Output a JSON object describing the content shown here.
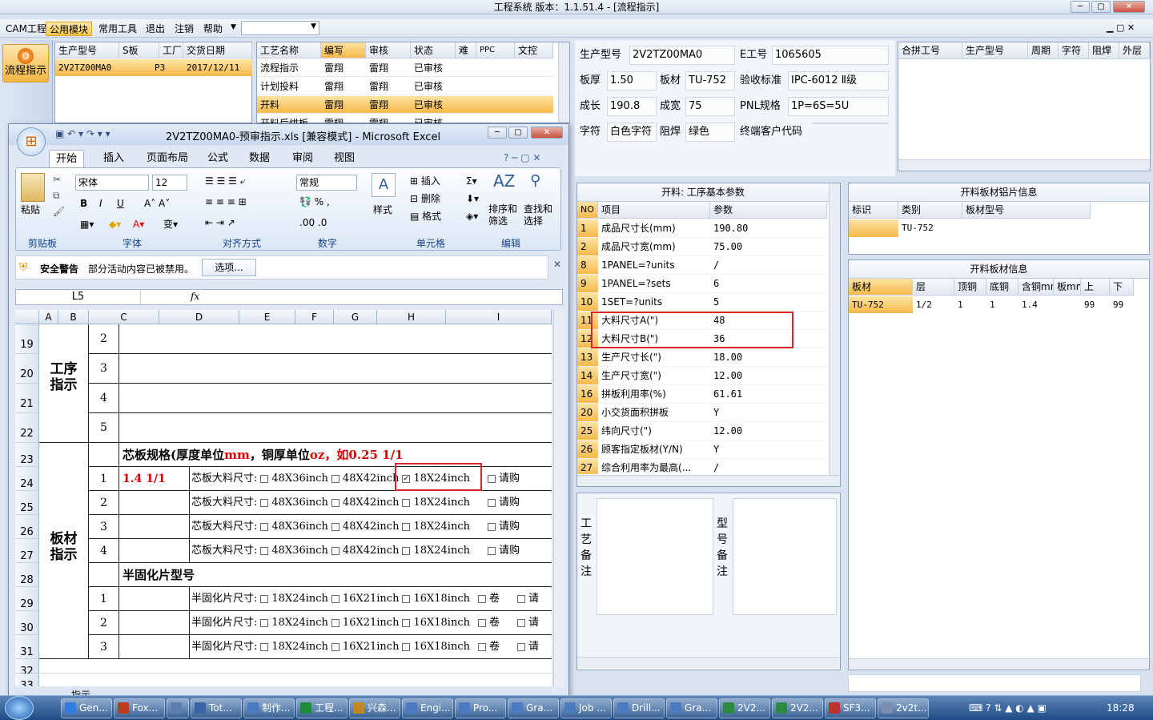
{
  "app": {
    "title": "工程系统   版本：1.1.51.4 - [流程指示]"
  },
  "menu": {
    "items": [
      "CAM工程",
      "公用模块",
      "常用工具",
      "退出",
      "注销",
      "帮助"
    ],
    "active_index": 1
  },
  "sidebar": {
    "button_label": "流程指示"
  },
  "product_grid": {
    "headers": [
      "生产型号",
      "S板",
      "工厂",
      "交货日期"
    ],
    "rows": [
      [
        "2V2TZ00MA0",
        "",
        "P3",
        "2017/12/11"
      ]
    ]
  },
  "process_grid": {
    "headers": [
      "工艺名称",
      "编写",
      "审核",
      "状态",
      "难",
      "PPC",
      "文控"
    ],
    "rows": [
      [
        "流程指示",
        "雷翔",
        "雷翔",
        "已审核"
      ],
      [
        "计划投料",
        "雷翔",
        "雷翔",
        "已审核"
      ],
      [
        "开料",
        "雷翔",
        "雷翔",
        "已审核"
      ],
      [
        "开料后烘板",
        "雷翔",
        "雷翔",
        "已审核"
      ]
    ],
    "selected_index": 2
  },
  "info": {
    "model_label": "生产型号",
    "model": "2V2TZ00MA0",
    "eno_label": "E工号",
    "eno": "1065605",
    "thick_label": "板厚",
    "thick": "1.50",
    "material_label": "板材",
    "material": "TU-752",
    "std_label": "验收标准",
    "std": "IPC-6012 Ⅱ级",
    "len_label": "成长",
    "len": "190.8",
    "wid_label": "成宽",
    "wid": "75",
    "pnl_label": "PNL规格",
    "pnl": "1P=6S=5U",
    "char_label": "字符",
    "char": "白色字符",
    "mask_label": "阻焊",
    "mask": "绿色",
    "cust_label": "终端客户代码",
    "cust": ""
  },
  "merge_grid": {
    "headers": [
      "合拼工号",
      "生产型号",
      "周期",
      "字符",
      "阻焊",
      "外层"
    ]
  },
  "params": {
    "title": "开料: 工序基本参数",
    "headers": [
      "NO",
      "项目",
      "参数"
    ],
    "rows": [
      [
        "1",
        "成品尺寸长(mm)",
        "190.80"
      ],
      [
        "2",
        "成品尺寸宽(mm)",
        "75.00"
      ],
      [
        "8",
        "1PANEL=?units",
        "/"
      ],
      [
        "9",
        "1PANEL=?sets",
        "6"
      ],
      [
        "10",
        "1SET=?units",
        "5"
      ],
      [
        "11",
        "大料尺寸A(\")",
        "48"
      ],
      [
        "12",
        "大料尺寸B(\")",
        "36"
      ],
      [
        "13",
        "生产尺寸长(\")",
        "18.00"
      ],
      [
        "14",
        "生产尺寸宽(\")",
        "12.00"
      ],
      [
        "16",
        "拼板利用率(%)",
        "61.61"
      ],
      [
        "20",
        "小交货面积拼板",
        "Y"
      ],
      [
        "25",
        "纬向尺寸(\")",
        "12.00"
      ],
      [
        "26",
        "顾客指定板材(Y/N)",
        "Y"
      ],
      [
        "27",
        "综合利用率为最高(...",
        "/"
      ]
    ]
  },
  "notes": {
    "process_label": "工艺备注",
    "model_label": "型号备注"
  },
  "cu_foil": {
    "title": "开料板材铝片信息",
    "headers": [
      "标识",
      "类别",
      "板材型号"
    ],
    "rows": [
      [
        "",
        "TU-752",
        ""
      ]
    ]
  },
  "board_info": {
    "title": "开料板材信息",
    "headers": [
      "板材",
      "层",
      "顶铜",
      "底铜",
      "含铜mm",
      "板mm",
      "上",
      "下"
    ],
    "rows": [
      [
        "TU-752",
        "1/2",
        "1",
        "1",
        "1.4",
        "",
        "99",
        "99"
      ]
    ]
  },
  "excel": {
    "title": "2V2TZ00MA0-预审指示.xls  [兼容模式] - Microsoft Excel",
    "tabs": [
      "开始",
      "插入",
      "页面布局",
      "公式",
      "数据",
      "审阅",
      "视图"
    ],
    "clipboard": {
      "paste": "粘贴",
      "group": "剪贴板"
    },
    "font": {
      "name": "宋体",
      "size": "12",
      "group": "字体"
    },
    "align_group": "对齐方式",
    "number": {
      "format": "常规",
      "group": "数字"
    },
    "styles": "样式",
    "cells": {
      "insert": "插入",
      "delete": "删除",
      "format": "格式",
      "group": "单元格"
    },
    "edit": {
      "sort": "排序和筛选",
      "find": "查找和选择",
      "group": "编辑"
    },
    "security": {
      "label": "安全警告",
      "text": "部分活动内容已被禁用。",
      "options": "选项..."
    },
    "namebox": "L5",
    "col_headers": [
      "A",
      "B",
      "C",
      "D",
      "E",
      "F",
      "G",
      "H",
      "I"
    ],
    "row_numbers": [
      "19",
      "20",
      "21",
      "22",
      "23",
      "24",
      "25",
      "26",
      "27",
      "28",
      "29",
      "30",
      "31",
      "32",
      "33"
    ],
    "process_label": "工序指示",
    "board_label": "板材指示",
    "steps": [
      "2",
      "3",
      "4",
      "5"
    ],
    "core_title_a": "芯板规格(厚度单位",
    "core_title_b": "mm",
    "core_title_c": "，铜厚单位",
    "core_title_d": "oz",
    "core_title_e": "，如0.25 1/1",
    "core_first_value": "1.4 1/1",
    "core_label": "芯板大料尺寸:",
    "core_options": [
      "48X36inch",
      "48X42inch",
      "18X24inch"
    ],
    "purchase": "请购",
    "core_rows": [
      "1",
      "2",
      "3",
      "4"
    ],
    "prepreg_title": "半固化片型号",
    "prepreg_label": "半固化片尺寸:",
    "prepreg_options": [
      "18X24inch",
      "16X21inch",
      "16X18inch"
    ],
    "roll": "卷",
    "req": "请",
    "prepreg_rows": [
      "1",
      "2",
      "3"
    ],
    "sheet_tab": "指示"
  },
  "taskbar": {
    "items": [
      "Gen...",
      "Fox...",
      "",
      "Tot...",
      "制作...",
      "工程...",
      "兴森...",
      "Engi...",
      "Pro...",
      "Gra...",
      "Job ...",
      "Drill...",
      "Gra...",
      "2V2...",
      "2V2...",
      "SF3...",
      "2v2t..."
    ],
    "time": "18:28"
  }
}
